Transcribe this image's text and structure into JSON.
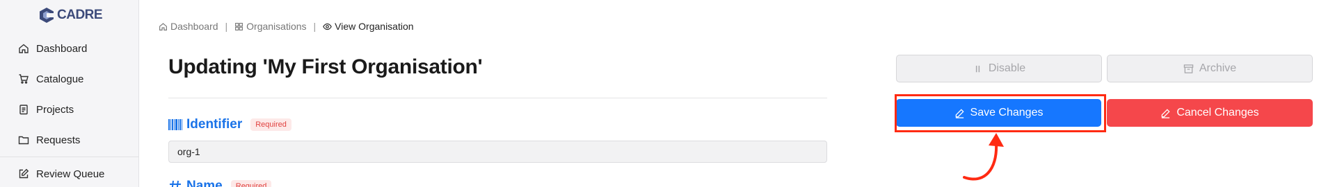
{
  "app": {
    "logo_text": "CADRE"
  },
  "sidebar": {
    "items": [
      {
        "label": "Dashboard",
        "icon": "home-icon"
      },
      {
        "label": "Catalogue",
        "icon": "cart-icon"
      },
      {
        "label": "Projects",
        "icon": "clipboard-icon"
      },
      {
        "label": "Requests",
        "icon": "folder-icon"
      },
      {
        "label": "Review Queue",
        "icon": "edit-square-icon"
      }
    ]
  },
  "breadcrumb": {
    "items": [
      {
        "label": "Dashboard",
        "icon": "home-icon"
      },
      {
        "label": "Organisations",
        "icon": "grid-icon"
      },
      {
        "label": "View Organisation",
        "icon": "eye-icon"
      }
    ],
    "separator": "|"
  },
  "page": {
    "title": "Updating 'My First Organisation'"
  },
  "form": {
    "identifier": {
      "label": "Identifier",
      "badge": "Required",
      "value": "org-1"
    },
    "name": {
      "label": "Name",
      "badge": "Required"
    }
  },
  "actions": {
    "disable_label": "Disable",
    "archive_label": "Archive",
    "save_label": "Save Changes",
    "cancel_label": "Cancel Changes"
  },
  "colors": {
    "primary": "#1677ff",
    "danger": "#f5474b",
    "accent": "#1a73e8",
    "annotation": "#ff2a12"
  }
}
